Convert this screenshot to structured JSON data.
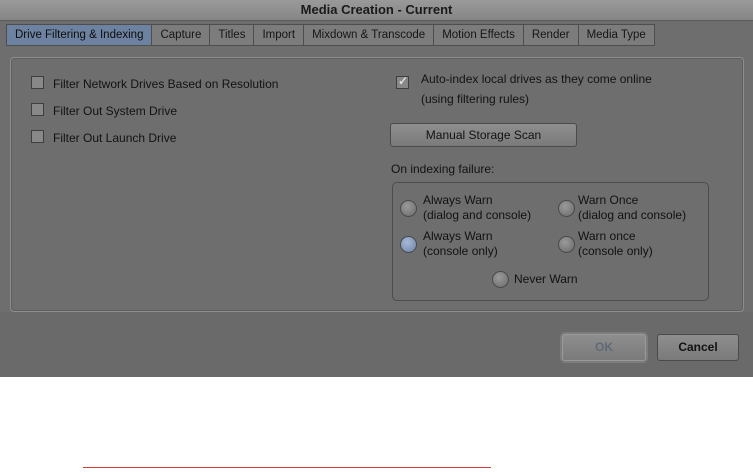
{
  "window": {
    "title": "Media Creation - Current"
  },
  "tabs": [
    {
      "label": "Drive Filtering & Indexing",
      "active": true
    },
    {
      "label": "Capture",
      "active": false
    },
    {
      "label": "Titles",
      "active": false
    },
    {
      "label": "Import",
      "active": false
    },
    {
      "label": "Mixdown & Transcode",
      "active": false
    },
    {
      "label": "Motion Effects",
      "active": false
    },
    {
      "label": "Render",
      "active": false
    },
    {
      "label": "Media Type",
      "active": false
    }
  ],
  "left_options": [
    {
      "label": "Filter Network Drives Based on Resolution",
      "checked": false
    },
    {
      "label": "Filter Out System Drive",
      "checked": false
    },
    {
      "label": "Filter Out Launch Drive",
      "checked": false
    }
  ],
  "auto_index": {
    "line1": "Auto-index local drives as they come online",
    "line2": "(using filtering rules)",
    "checked": true
  },
  "manual_scan_label": "Manual Storage Scan",
  "failure": {
    "heading": "On indexing failure:",
    "options": [
      {
        "line1": "Always Warn",
        "line2": "(dialog and console)",
        "selected": false
      },
      {
        "line1": "Warn Once",
        "line2": "(dialog and console)",
        "selected": false
      },
      {
        "line1": "Always Warn",
        "line2": "(console only)",
        "selected": true
      },
      {
        "line1": "Warn once",
        "line2": "(console only)",
        "selected": false
      },
      {
        "line1": "Never Warn",
        "line2": "",
        "selected": false
      }
    ]
  },
  "buttons": {
    "ok": "OK",
    "cancel": "Cancel"
  },
  "colors": {
    "active_tab": "#6c82a0",
    "selected_radio": "#8aa0c4",
    "annotation_line": "#d63a3a"
  }
}
